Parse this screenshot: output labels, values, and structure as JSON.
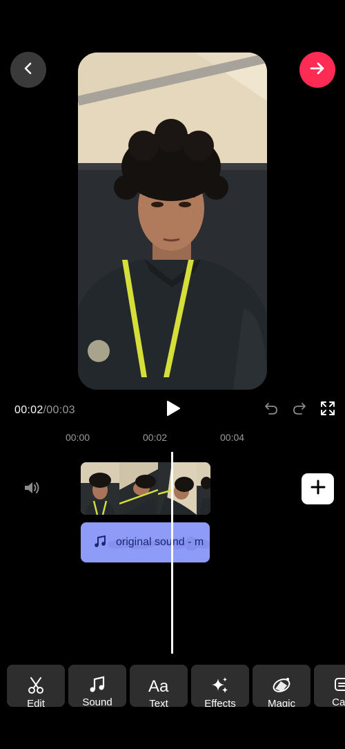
{
  "header": {
    "back_icon": "chevron-left-icon",
    "next_icon": "arrow-right-icon",
    "next_color": "#fe2c55"
  },
  "playback": {
    "current_time": "00:02",
    "separator": "/",
    "duration": "00:03"
  },
  "ruler": {
    "labels": [
      "00:00",
      "00:02",
      "00:04"
    ]
  },
  "timeline": {
    "audio_label": "original sound - m",
    "audio_color": "#8e9cf7"
  },
  "toolbar": {
    "items": [
      {
        "label": "Edit",
        "icon": "scissors-icon"
      },
      {
        "label": "Sound",
        "icon": "music-note-icon"
      },
      {
        "label": "Text",
        "icon": "text-aa-icon"
      },
      {
        "label": "Effects",
        "icon": "sparkle-icon"
      },
      {
        "label": "Magic",
        "icon": "magic-eraser-icon"
      },
      {
        "label": "Capt",
        "icon": "captions-icon"
      }
    ]
  }
}
